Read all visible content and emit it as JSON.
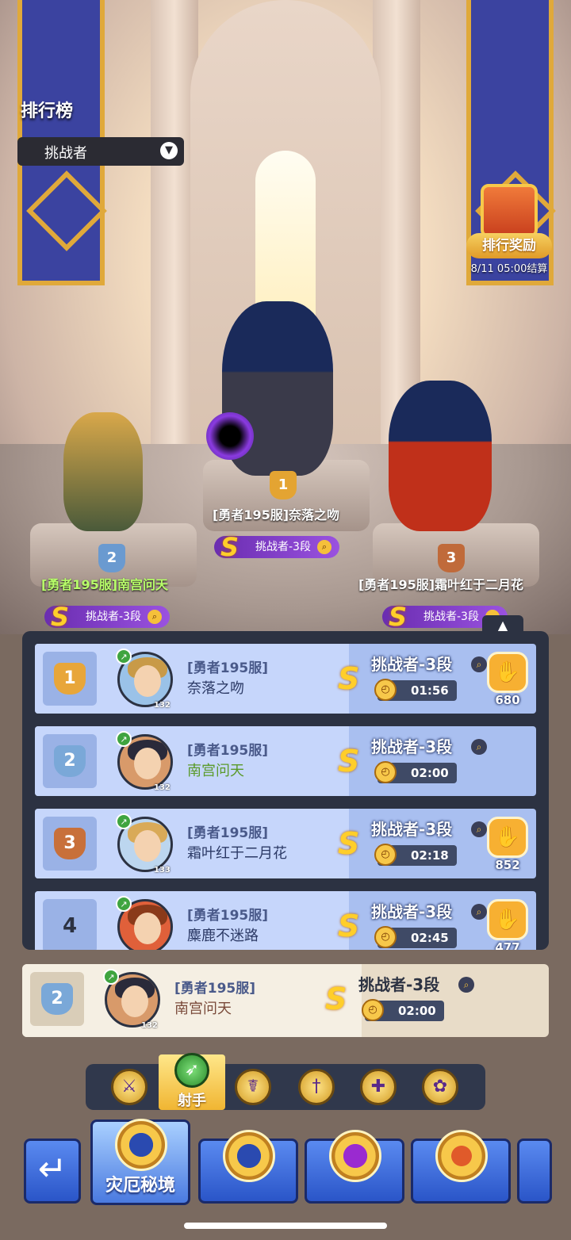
{
  "header": {
    "title": "排行榜",
    "dropdown_value": "挑战者"
  },
  "reward": {
    "label": "排行奖励",
    "settle_time": "8/11 05:00结算"
  },
  "podium": [
    {
      "rank": "1",
      "name": "[勇者195服]奈落之吻",
      "tier": "挑战者-3段"
    },
    {
      "rank": "2",
      "name": "[勇者195服]南宫问天",
      "tier": "挑战者-3段"
    },
    {
      "rank": "3",
      "name": "[勇者195服]霜叶红于二月花",
      "tier": "挑战者-3段"
    }
  ],
  "leaderboard": [
    {
      "rank": "1",
      "server": "[勇者195服]",
      "name": "奈落之吻",
      "level": "132",
      "tier": "挑战者-3段",
      "time": "01:56",
      "likes": "680"
    },
    {
      "rank": "2",
      "server": "[勇者195服]",
      "name": "南宫问天",
      "level": "132",
      "tier": "挑战者-3段",
      "time": "02:00",
      "likes": ""
    },
    {
      "rank": "3",
      "server": "[勇者195服]",
      "name": "霜叶红于二月花",
      "level": "133",
      "tier": "挑战者-3段",
      "time": "02:18",
      "likes": "852"
    },
    {
      "rank": "4",
      "server": "[勇者195服]",
      "name": "麋鹿不迷路",
      "level": "",
      "tier": "挑战者-3段",
      "time": "02:45",
      "likes": "477"
    }
  ],
  "my_rank": {
    "rank": "2",
    "server": "[勇者195服]",
    "name": "南宫问天",
    "level": "132",
    "tier": "挑战者-3段",
    "time": "02:00"
  },
  "class_tabs": {
    "active_label": "射手"
  },
  "modes": {
    "active_label": "灾厄秘境"
  },
  "colors": {
    "row_bg": "#a9bff0",
    "accent_gold": "#f7c84a",
    "tier_purple": "#7a3dc8"
  }
}
